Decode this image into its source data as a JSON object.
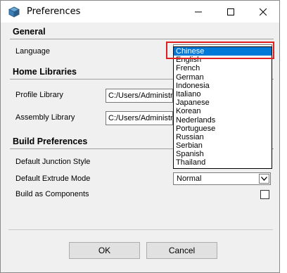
{
  "window": {
    "title": "Preferences"
  },
  "general": {
    "heading": "General",
    "language_label": "Language",
    "language_selected": "Chinese",
    "language_options": [
      "Chinese",
      "English",
      "French",
      "German",
      "Indonesia",
      "Italiano",
      "Japanese",
      "Korean",
      "Nederlands",
      "Portuguese",
      "Russian",
      "Serbian",
      "Spanish",
      "Thailand"
    ]
  },
  "home_libraries": {
    "heading": "Home Libraries",
    "profile_label": "Profile Library",
    "profile_value": "C:/Users/Administrat",
    "assembly_label": "Assembly Library",
    "assembly_value": "C:/Users/Administrat"
  },
  "build": {
    "heading": "Build Preferences",
    "junction_label": "Default Junction Style",
    "extrude_label": "Default Extrude Mode",
    "extrude_value": "Normal",
    "components_label": "Build as Components",
    "components_checked": false
  },
  "buttons": {
    "ok": "OK",
    "cancel": "Cancel"
  },
  "colors": {
    "selection": "#0078d7",
    "highlight": "#e02020"
  }
}
